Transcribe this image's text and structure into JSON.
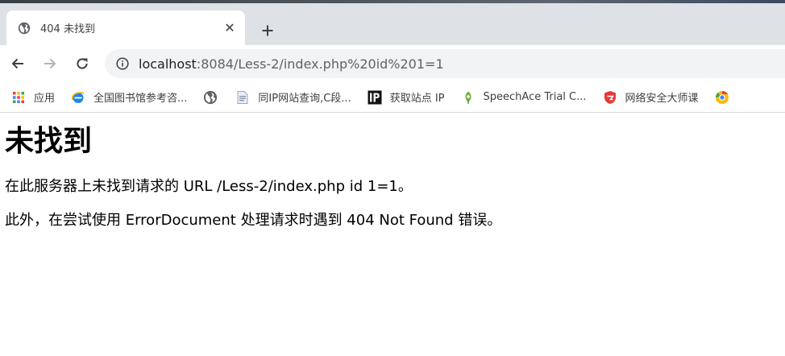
{
  "tab": {
    "title": "404 未找到",
    "close_glyph": "✕",
    "favicon": "globe-icon"
  },
  "new_tab": {
    "glyph": "+"
  },
  "toolbar": {
    "back": "arrow-left-icon",
    "forward": "arrow-right-icon",
    "reload": "reload-icon"
  },
  "address_bar": {
    "host": "localhost",
    "rest": ":8084/Less-2/index.php%20id%201=1",
    "security_icon": "info-icon"
  },
  "bookmarks": [
    {
      "label": "应用",
      "icon": "apps-grid-icon"
    },
    {
      "label": "全国图书馆参考咨...",
      "icon": "ie-icon"
    },
    {
      "label": "",
      "icon": "globe-icon"
    },
    {
      "label": "同IP网站查询,C段...",
      "icon": "document-icon"
    },
    {
      "label": "获取站点 IP",
      "icon": "ip-icon"
    },
    {
      "label": "SpeechAce Trial C...",
      "icon": "leaf-icon"
    },
    {
      "label": "网络安全大师课",
      "icon": "shield-icon"
    }
  ],
  "page": {
    "heading": "未找到",
    "line1": "在此服务器上未找到请求的 URL /Less-2/index.php id 1=1。",
    "line2": "此外，在尝试使用 ErrorDocument 处理请求时遇到 404 Not Found 错误。"
  },
  "colors": {
    "tabbar_bg": "#dee1e6",
    "omnibox_bg": "#f1f3f4",
    "text": "#3c4043"
  }
}
